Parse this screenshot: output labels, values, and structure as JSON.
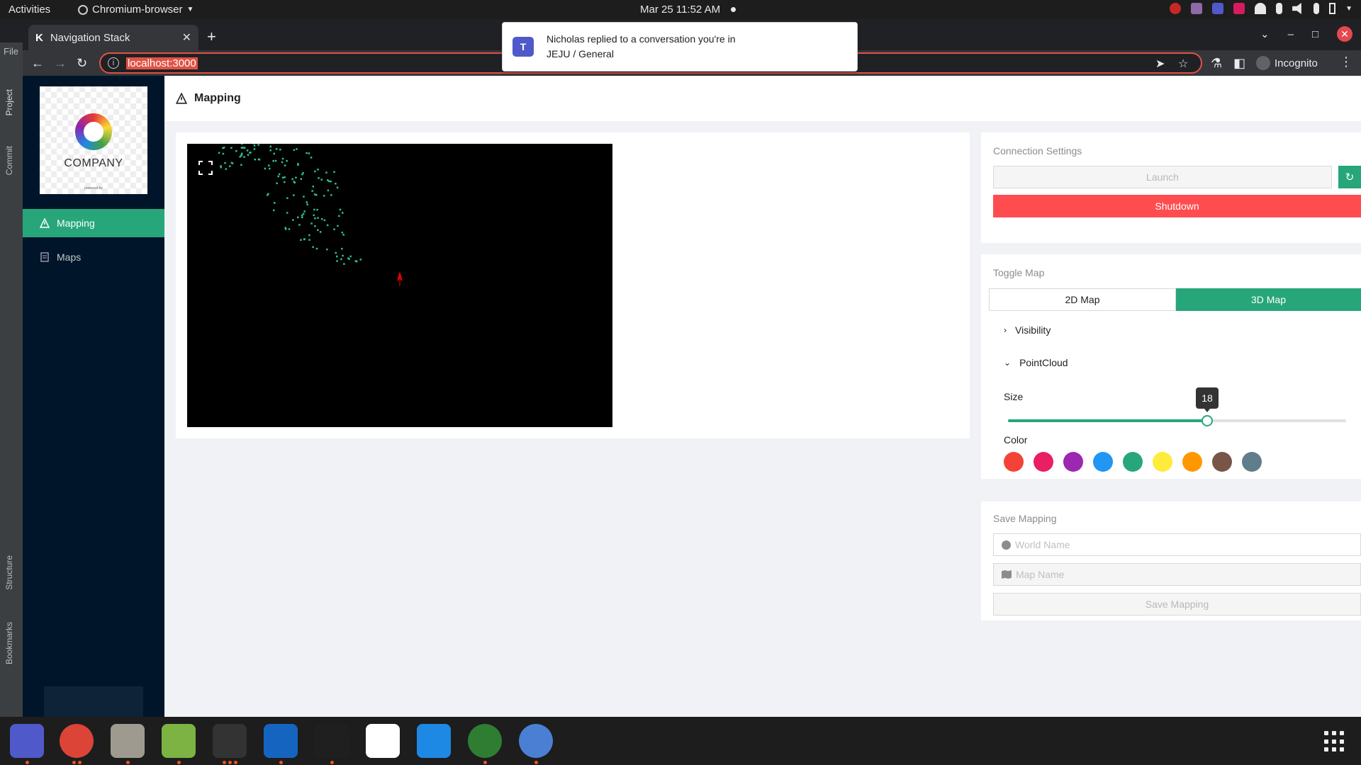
{
  "system_bar": {
    "activities": "Activities",
    "app_menu": "Chromium-browser",
    "clock": "Mar 25  11:52 AM"
  },
  "browser": {
    "tab_title": "Navigation Stack",
    "url": "localhost:3000",
    "incognito_label": "Incognito"
  },
  "ide_strip": {
    "file": "File",
    "project": "Project",
    "commit": "Commit",
    "structure": "Structure",
    "bookmarks": "Bookmarks"
  },
  "notification": {
    "line1": "Nicholas replied to a conversation you're in",
    "line2": "JEJU / General"
  },
  "sidebar": {
    "logo_text": "COMPANY",
    "items": [
      {
        "label": "Mapping",
        "icon": "warning-triangle-icon",
        "active": true
      },
      {
        "label": "Maps",
        "icon": "document-icon",
        "active": false
      }
    ]
  },
  "header": {
    "title": "Mapping"
  },
  "connection": {
    "title": "Connection Settings",
    "launch_label": "Launch",
    "shutdown_label": "Shutdown"
  },
  "toggle_map": {
    "title": "Toggle Map",
    "options": [
      "2D Map",
      "3D Map"
    ],
    "selected": "3D Map",
    "visibility_label": "Visibility",
    "pointcloud_label": "PointCloud",
    "size_label": "Size",
    "size_value": "18",
    "size_fraction": 0.59,
    "color_label": "Color",
    "colors": [
      "#f44336",
      "#e91e63",
      "#9c27b0",
      "#2196f3",
      "#27a67a",
      "#ffeb3b",
      "#ff9800",
      "#795548",
      "#607d8b"
    ]
  },
  "save_mapping": {
    "title": "Save Mapping",
    "world_placeholder": "World Name",
    "map_placeholder": "Map Name",
    "save_label": "Save Mapping"
  },
  "colors": {
    "accent": "#27a67a",
    "danger": "#ff4d4f",
    "sidebar_bg": "#001529"
  }
}
